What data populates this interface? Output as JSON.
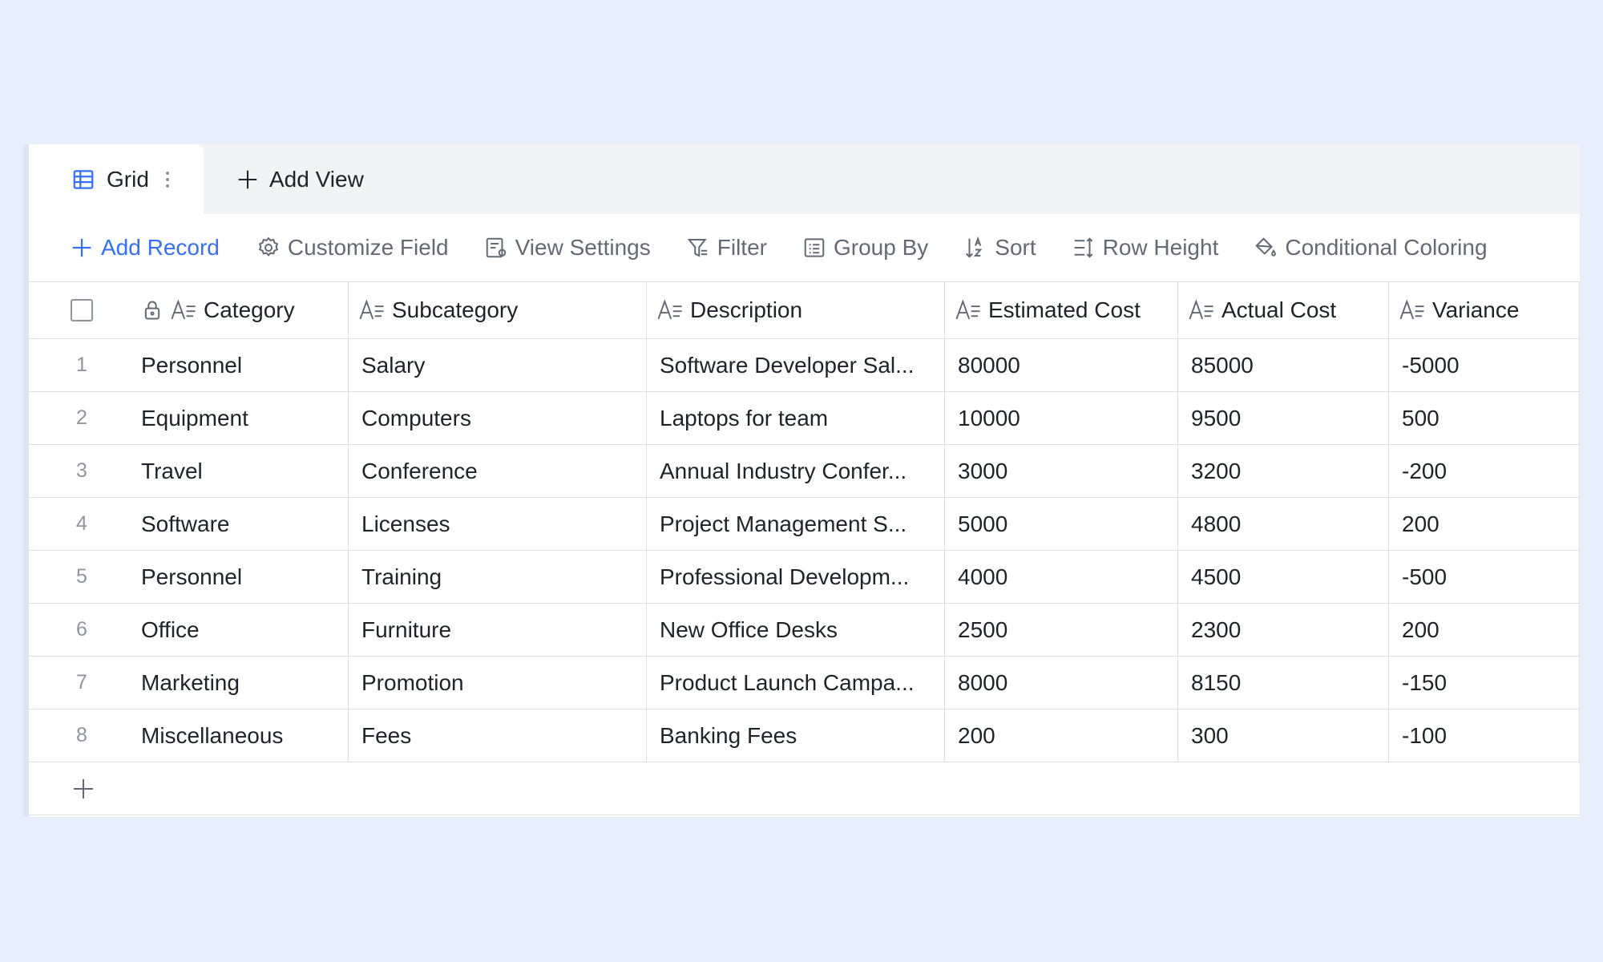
{
  "tabs": {
    "active_label": "Grid",
    "add_view_label": "Add View"
  },
  "toolbar": {
    "add_record": "Add Record",
    "customize_field": "Customize Field",
    "view_settings": "View Settings",
    "filter": "Filter",
    "group_by": "Group By",
    "sort": "Sort",
    "row_height": "Row Height",
    "conditional_coloring": "Conditional Coloring"
  },
  "columns": {
    "category": "Category",
    "subcategory": "Subcategory",
    "description": "Description",
    "estimated_cost": "Estimated Cost",
    "actual_cost": "Actual Cost",
    "variance": "Variance"
  },
  "rows": [
    {
      "index": "1",
      "category": "Personnel",
      "subcategory": "Salary",
      "description": "Software Developer Sal...",
      "estimated_cost": "80000",
      "actual_cost": "85000",
      "variance": "-5000"
    },
    {
      "index": "2",
      "category": "Equipment",
      "subcategory": "Computers",
      "description": "Laptops for team",
      "estimated_cost": "10000",
      "actual_cost": "9500",
      "variance": "500"
    },
    {
      "index": "3",
      "category": "Travel",
      "subcategory": "Conference",
      "description": "Annual Industry Confer...",
      "estimated_cost": "3000",
      "actual_cost": "3200",
      "variance": "-200"
    },
    {
      "index": "4",
      "category": "Software",
      "subcategory": "Licenses",
      "description": "Project Management S...",
      "estimated_cost": "5000",
      "actual_cost": "4800",
      "variance": "200"
    },
    {
      "index": "5",
      "category": "Personnel",
      "subcategory": "Training",
      "description": "Professional Developm...",
      "estimated_cost": "4000",
      "actual_cost": "4500",
      "variance": "-500"
    },
    {
      "index": "6",
      "category": "Office",
      "subcategory": "Furniture",
      "description": "New Office Desks",
      "estimated_cost": "2500",
      "actual_cost": "2300",
      "variance": "200"
    },
    {
      "index": "7",
      "category": "Marketing",
      "subcategory": "Promotion",
      "description": "Product Launch Campa...",
      "estimated_cost": "8000",
      "actual_cost": "8150",
      "variance": "-150"
    },
    {
      "index": "8",
      "category": "Miscellaneous",
      "subcategory": "Fees",
      "description": "Banking Fees",
      "estimated_cost": "200",
      "actual_cost": "300",
      "variance": "-100"
    }
  ],
  "colors": {
    "accent": "#3370ff",
    "background": "#e8effc",
    "toolbar_text": "#646a73",
    "border": "#dee0e3"
  }
}
